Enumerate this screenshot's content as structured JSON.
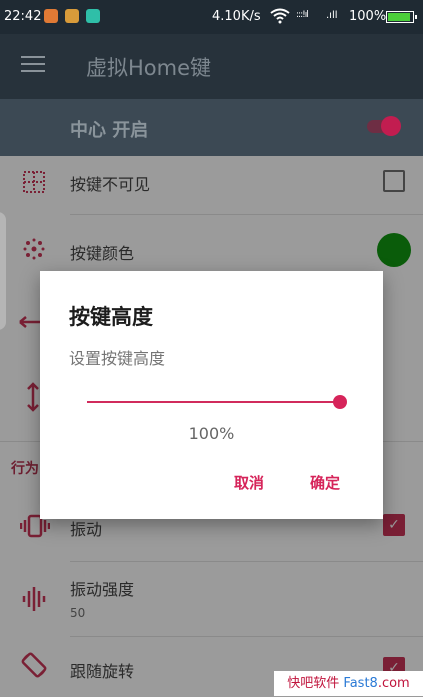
{
  "status": {
    "time": "22:42",
    "net_speed": "4.10K/s",
    "signal_a": ":::!ıl",
    "signal_b": ".ıll",
    "battery": "100%"
  },
  "appbar": {
    "title": "虚拟Home键"
  },
  "master": {
    "label": "中心 开启",
    "on": true
  },
  "list": {
    "invisible_label": "按键不可见",
    "invisible_checked": false,
    "color_label": "按键颜色",
    "button_color": "#0a7a0a",
    "section_label": "行为",
    "vibrate_label": "振动",
    "vibrate_checked": true,
    "intensity_label": "振动强度",
    "intensity_value": "50",
    "rotate_label": "跟随旋转",
    "rotate_checked": true
  },
  "dialog": {
    "title": "按键高度",
    "message": "设置按键高度",
    "slider_fraction": 1.0,
    "value_text": "100%",
    "cancel": "取消",
    "ok": "确定"
  },
  "watermark": {
    "text_a": "快吧软件",
    "text_b": "Fast8",
    "text_c": ".com"
  },
  "colors": {
    "accent": "#d6245a",
    "appbar": "#27323b",
    "statusbar": "#1f2a33"
  }
}
